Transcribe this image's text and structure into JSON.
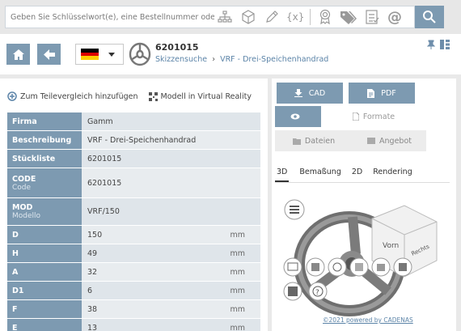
{
  "search": {
    "placeholder": "Geben Sie Schlüsselwort(e), eine Bestellnummer oder",
    "icons": [
      "hierarchy-icon",
      "cube-icon",
      "pencil-icon",
      "variable-icon",
      "certificate-icon",
      "tags-icon",
      "checklist-icon",
      "at-icon",
      "search-icon"
    ]
  },
  "header": {
    "part_number": "6201015",
    "breadcrumb": [
      "Skizzensuche",
      "VRF - Drei-Speichenhandrad"
    ],
    "language": "de"
  },
  "actions": {
    "compare": "Zum Teilevergleich hinzufügen",
    "vr": "Modell in Virtual Reality"
  },
  "properties": [
    {
      "key": "Firma",
      "sub": "",
      "value": "Gamm",
      "unit": ""
    },
    {
      "key": "Beschreibung",
      "sub": "",
      "value": "VRF - Drei-Speichenhandrad",
      "unit": ""
    },
    {
      "key": "Stückliste",
      "sub": "",
      "value": "6201015",
      "unit": ""
    },
    {
      "key": "CODE",
      "sub": "Code",
      "value": "6201015",
      "unit": ""
    },
    {
      "key": "MOD",
      "sub": "Modello",
      "value": "VRF/150",
      "unit": ""
    },
    {
      "key": "D",
      "sub": "",
      "value": "150",
      "unit": "mm"
    },
    {
      "key": "H",
      "sub": "",
      "value": "49",
      "unit": "mm"
    },
    {
      "key": "A",
      "sub": "",
      "value": "32",
      "unit": "mm"
    },
    {
      "key": "D1",
      "sub": "",
      "value": "6",
      "unit": "mm"
    },
    {
      "key": "F",
      "sub": "",
      "value": "38",
      "unit": "mm"
    },
    {
      "key": "E",
      "sub": "",
      "value": "13",
      "unit": "mm"
    }
  ],
  "right": {
    "cad": "CAD",
    "pdf": "PDF",
    "formate": "Formate",
    "dateien": "Dateien",
    "angebot": "Angebot",
    "view_tabs": [
      "3D",
      "Bemaßung",
      "2D",
      "Rendering"
    ],
    "cube_front": "Vorn",
    "cube_right": "Rechts",
    "powered": "©2021 powered by CADENAS"
  },
  "colors": {
    "accent": "#7d9ab1",
    "key_bg": "#7d9ab1",
    "value_bg": "#dfe5ea",
    "link": "#5c84a8"
  }
}
